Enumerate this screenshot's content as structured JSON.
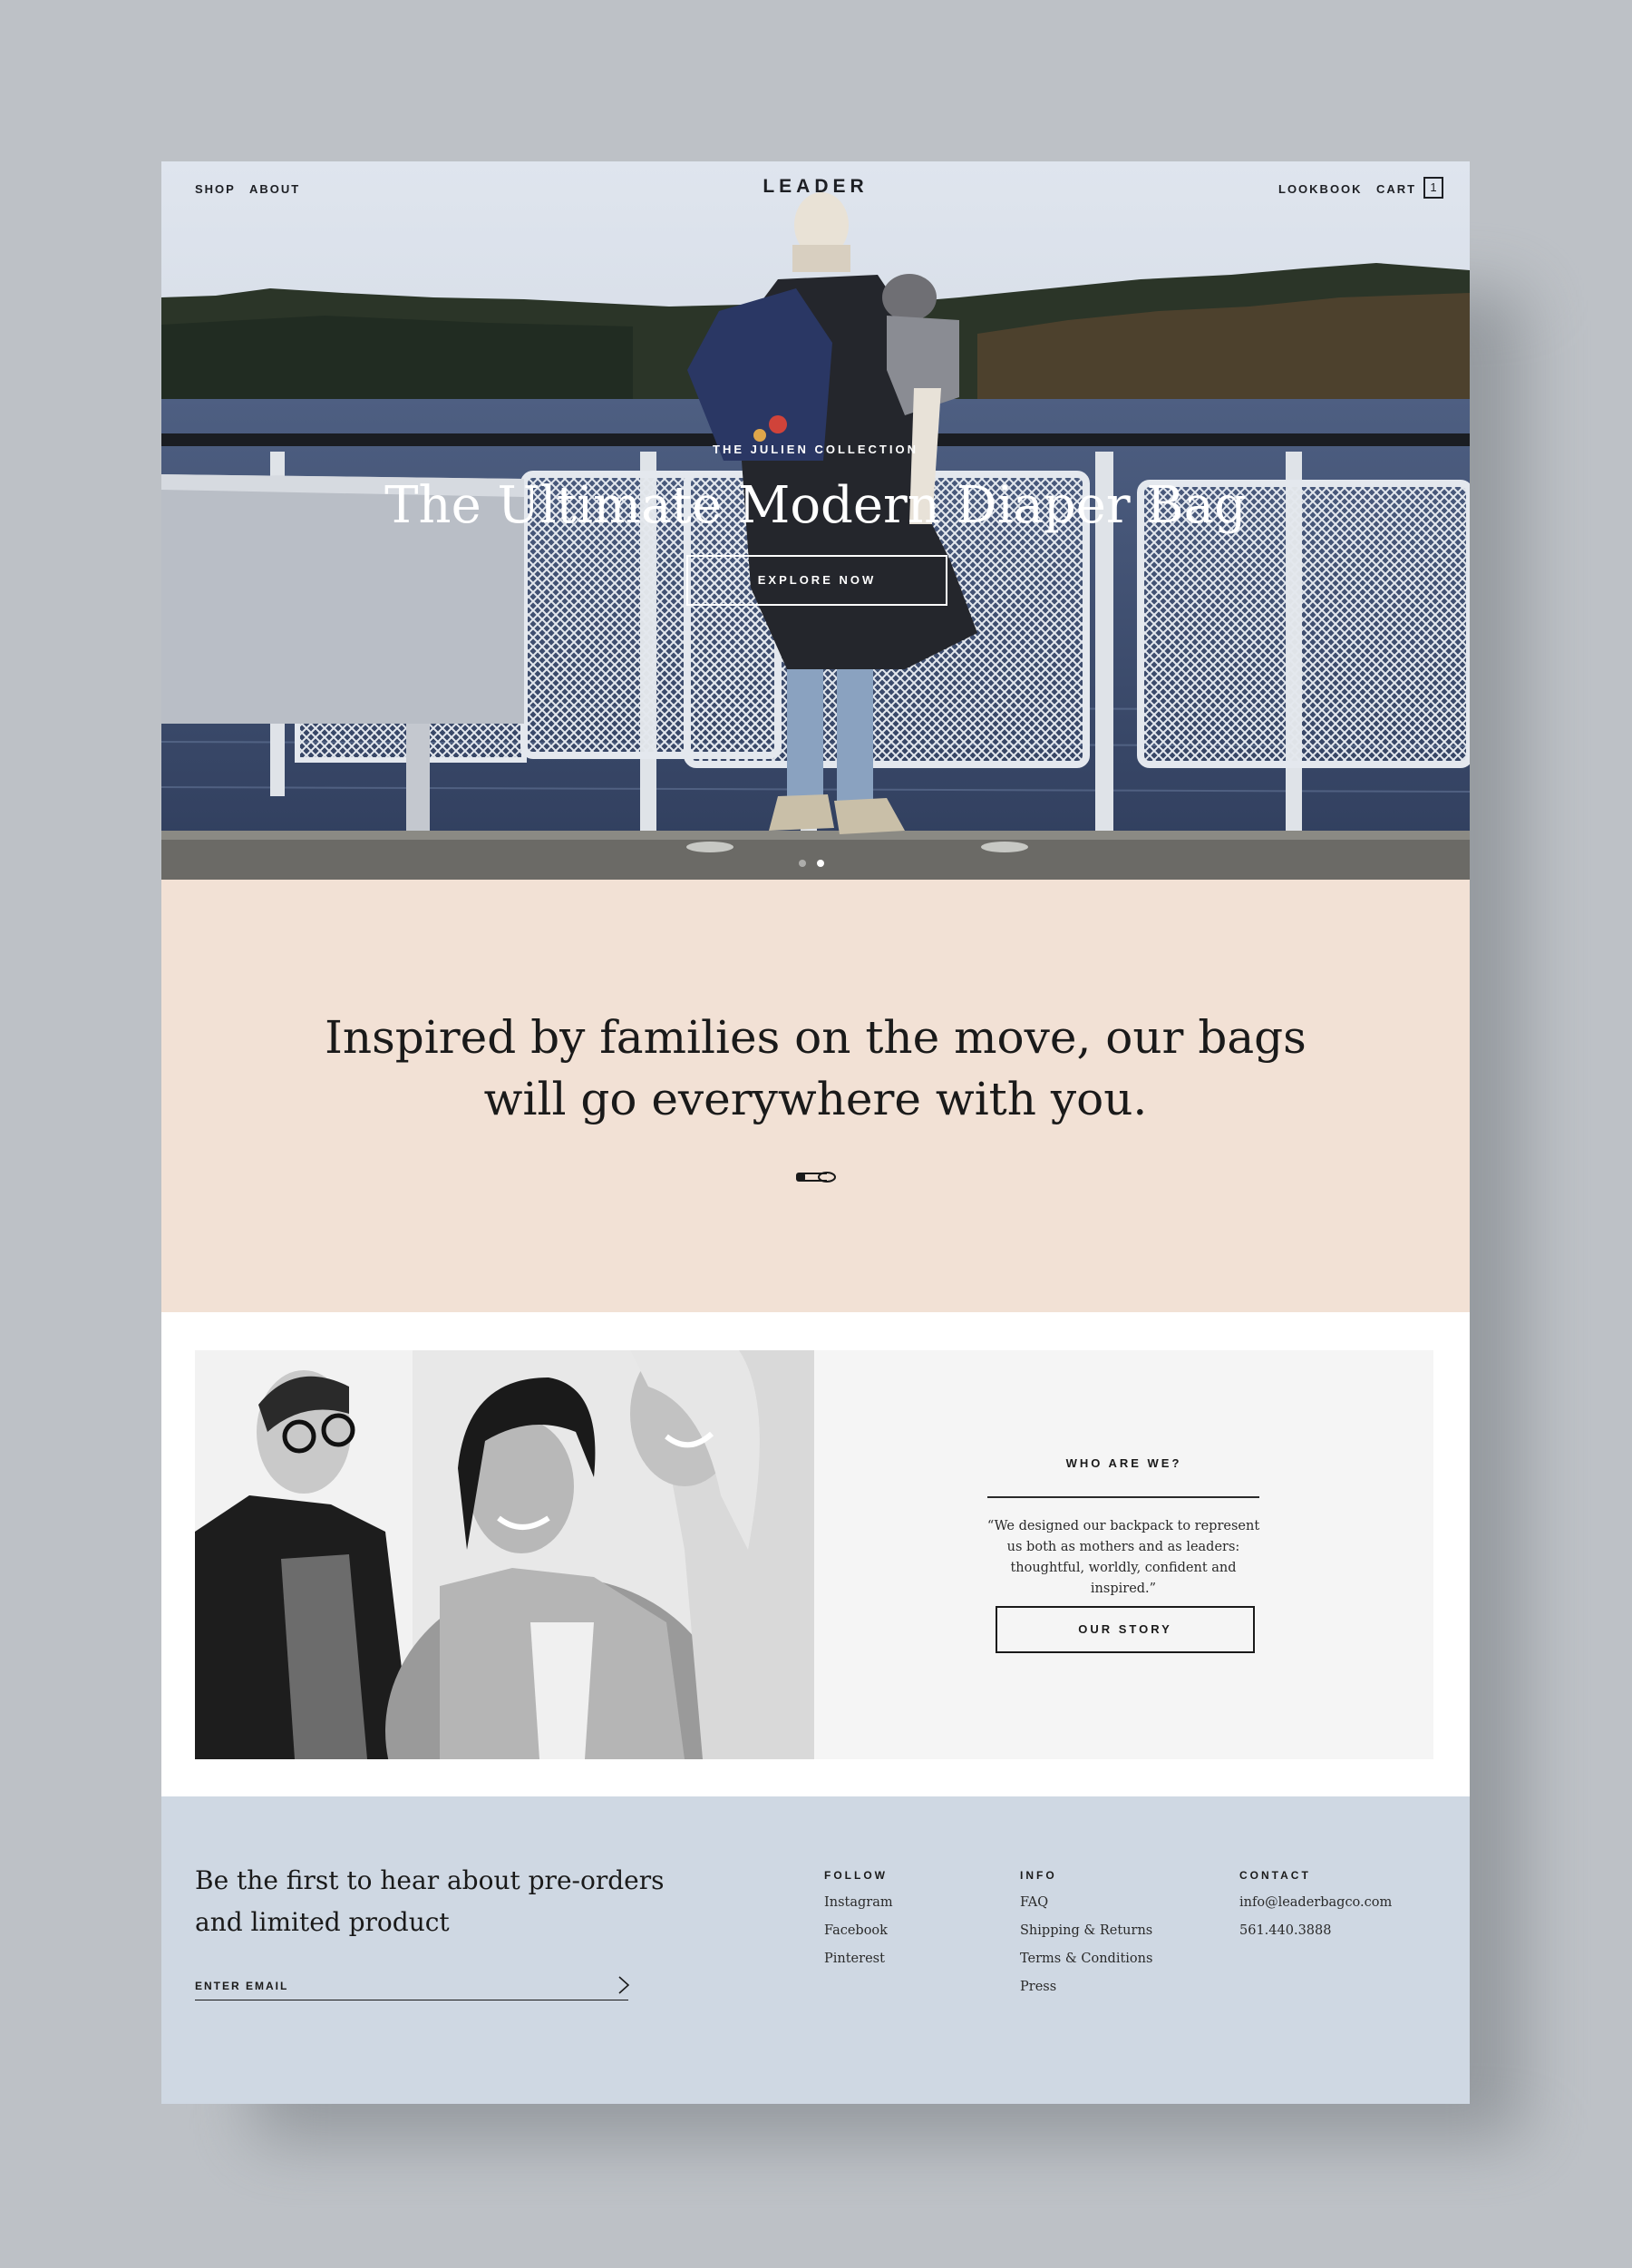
{
  "nav": {
    "left": [
      "SHOP",
      "ABOUT"
    ],
    "logo": "LEADER",
    "lookbook": "LOOKBOOK",
    "cart_label": "CART",
    "cart_count": "1"
  },
  "hero": {
    "kicker": "THE JULIEN COLLECTION",
    "title": "The Ultimate Modern Diaper Bag",
    "button": "EXPLORE NOW",
    "slides": 2,
    "active_slide": 2
  },
  "tagline": {
    "line1": "Inspired by families on the move, our bags",
    "line2": "will go everywhere with you.",
    "icon": "safety-pin-icon"
  },
  "about": {
    "title": "WHO ARE WE?",
    "quote": "“We designed our backpack to represent us both as mothers and as leaders: thoughtful, worldly, confident and inspired.”",
    "button": "OUR STORY"
  },
  "footer": {
    "signup": {
      "heading": "Be the first to hear about pre-orders and limited product",
      "placeholder": "ENTER EMAIL",
      "submit_icon": "chevron-right-icon"
    },
    "follow": {
      "title": "FOLLOW",
      "links": [
        "Instagram",
        "Facebook",
        "Pinterest"
      ]
    },
    "info": {
      "title": "INFO",
      "links": [
        "FAQ",
        "Shipping & Returns",
        "Terms & Conditions",
        "Press"
      ]
    },
    "contact": {
      "title": "CONTACT",
      "links": [
        "info@leaderbagco.com",
        "561.440.3888"
      ]
    }
  },
  "colors": {
    "backdrop": "#bdc1c6",
    "tagline_bg": "#f2e1d5",
    "footer_bg": "#cfd8e3",
    "panel_bg": "#f5f5f5",
    "text": "#1a1a1a"
  }
}
